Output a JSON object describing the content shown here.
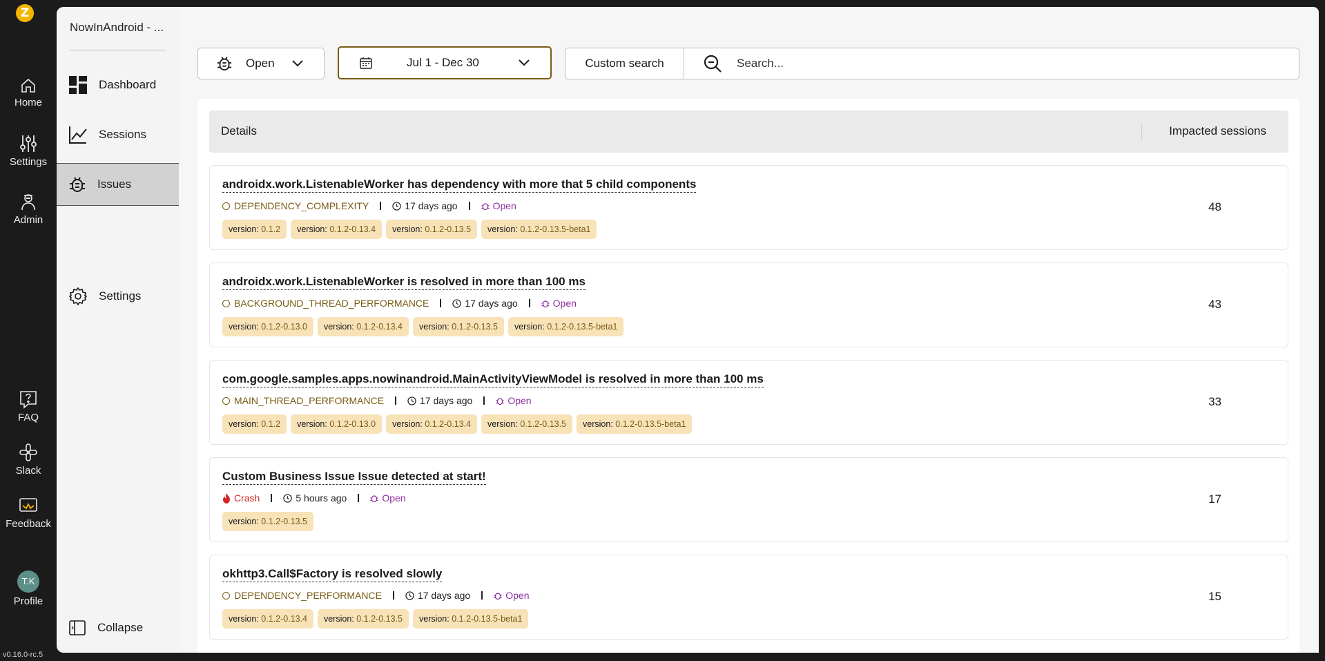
{
  "app": {
    "logo_letter": "Z",
    "version": "v0.16.0-rc.5"
  },
  "rail": {
    "items": [
      {
        "label": "Home",
        "icon": "home-icon"
      },
      {
        "label": "Settings",
        "icon": "sliders-icon"
      },
      {
        "label": "Admin",
        "icon": "admin-icon"
      },
      {
        "label": "FAQ",
        "icon": "faq-icon"
      },
      {
        "label": "Slack",
        "icon": "slack-icon"
      },
      {
        "label": "Feedback",
        "icon": "feedback-icon"
      }
    ],
    "profile": {
      "initials": "T.K",
      "label": "Profile"
    }
  },
  "sidebar": {
    "project_name": "NowInAndroid - ...",
    "items": [
      {
        "label": "Dashboard",
        "icon": "dashboard-icon"
      },
      {
        "label": "Sessions",
        "icon": "chart-line-icon"
      },
      {
        "label": "Issues",
        "icon": "bug-icon",
        "active": true
      },
      {
        "label": "Settings",
        "icon": "gear-icon"
      }
    ],
    "collapse_label": "Collapse"
  },
  "filters": {
    "status": "Open",
    "date_range": "Jul 1 - Dec 30",
    "custom_search_label": "Custom search",
    "search_placeholder": "Search..."
  },
  "table": {
    "header_details": "Details",
    "header_sessions": "Impacted sessions"
  },
  "issues": [
    {
      "title": "androidx.work.ListenableWorker has dependency with more that 5 child components",
      "type": "DEPENDENCY_COMPLEXITY",
      "time": "17 days ago",
      "status": "Open",
      "tags": [
        "0.1.2",
        "0.1.2-0.13.4",
        "0.1.2-0.13.5",
        "0.1.2-0.13.5-beta1"
      ],
      "sessions": "48"
    },
    {
      "title": "androidx.work.ListenableWorker is resolved in more than 100 ms",
      "type": "BACKGROUND_THREAD_PERFORMANCE",
      "time": "17 days ago",
      "status": "Open",
      "tags": [
        "0.1.2-0.13.0",
        "0.1.2-0.13.4",
        "0.1.2-0.13.5",
        "0.1.2-0.13.5-beta1"
      ],
      "sessions": "43"
    },
    {
      "title": "com.google.samples.apps.nowinandroid.MainActivityViewModel is resolved in more than 100 ms",
      "type": "MAIN_THREAD_PERFORMANCE",
      "time": "17 days ago",
      "status": "Open",
      "tags": [
        "0.1.2",
        "0.1.2-0.13.0",
        "0.1.2-0.13.4",
        "0.1.2-0.13.5",
        "0.1.2-0.13.5-beta1"
      ],
      "sessions": "33"
    },
    {
      "title": "Custom Business Issue Issue detected at start!",
      "type": "Crash",
      "time": "5 hours ago",
      "status": "Open",
      "tags": [
        "0.1.2-0.13.5"
      ],
      "sessions": "17"
    },
    {
      "title": "okhttp3.Call$Factory is resolved slowly",
      "type": "DEPENDENCY_PERFORMANCE",
      "time": "17 days ago",
      "status": "Open",
      "tags": [
        "0.1.2-0.13.4",
        "0.1.2-0.13.5",
        "0.1.2-0.13.5-beta1"
      ],
      "sessions": "15"
    }
  ],
  "tag_label": "version:",
  "colors": {
    "accent_gold": "#7a5c14",
    "tag_bg": "#f8e2b8",
    "status_purple": "#8b2fa0",
    "crash_red": "#d02626",
    "rail_bg": "#1b1b1b"
  }
}
